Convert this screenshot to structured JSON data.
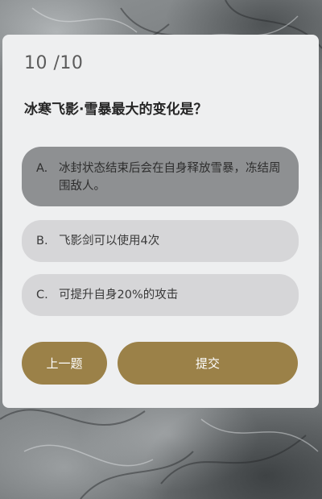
{
  "quiz": {
    "progress": "10 /10",
    "question": "冰寒飞影·雪暴最大的变化是？",
    "options": [
      {
        "letter": "A.",
        "text": "冰封状态结束后会在自身释放雪暴，冻结周围敌人。",
        "selected": true
      },
      {
        "letter": "B.",
        "text": "飞影剑可以使用4次",
        "selected": false
      },
      {
        "letter": "C.",
        "text": "可提升自身20%的攻击",
        "selected": false
      }
    ],
    "buttons": {
      "prev_label": "上一题",
      "submit_label": "提交"
    }
  },
  "colors": {
    "card_bg": "#eeeff0",
    "option_bg": "#d6d6d8",
    "option_selected_bg": "#8e9092",
    "button_bg": "#9b8148",
    "button_text": "#ffffff"
  }
}
